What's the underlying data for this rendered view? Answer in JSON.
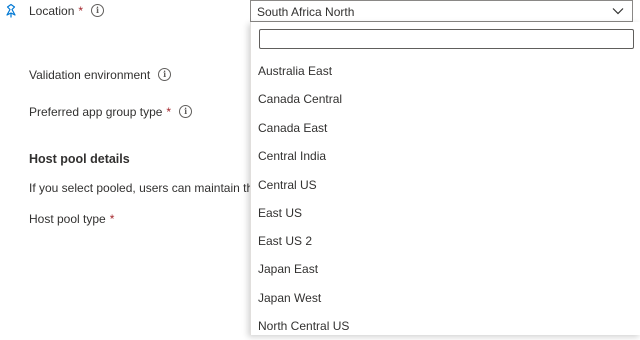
{
  "form": {
    "location": {
      "label": "Location",
      "required": "*"
    },
    "validation": {
      "label": "Validation environment"
    },
    "app_group": {
      "label": "Preferred app group type",
      "required": "*"
    },
    "host_pool_details": {
      "title": "Host pool details",
      "description": "If you select pooled, users can maintain thei"
    },
    "host_pool_type": {
      "label": "Host pool type",
      "required": "*"
    }
  },
  "location_select": {
    "value": "South Africa North",
    "filter_value": "",
    "options": [
      "Australia East",
      "Canada Central",
      "Canada East",
      "Central India",
      "Central US",
      "East US",
      "East US 2",
      "Japan East",
      "Japan West",
      "North Central US"
    ]
  },
  "icons": {
    "row_icon": "pin-icon",
    "info": "info-icon",
    "chevron": "chevron-down-icon"
  },
  "colors": {
    "required": "#a4262c",
    "text": "#323130",
    "border": "#8a8886",
    "icon_accent": "#0078d4"
  }
}
